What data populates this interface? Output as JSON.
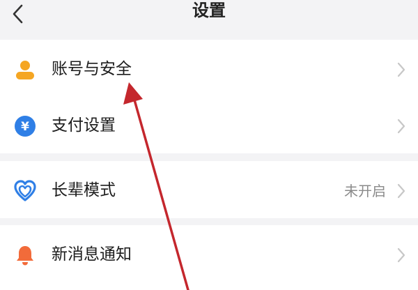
{
  "header": {
    "title": "设置",
    "back_icon": "chevron-left-icon"
  },
  "groups": [
    {
      "items": [
        {
          "label": "账号与安全",
          "icon": "user-icon",
          "icon_color": "#f5a623"
        },
        {
          "label": "支付设置",
          "icon": "yen-coin-icon",
          "icon_color": "#2f7fe6"
        }
      ]
    },
    {
      "items": [
        {
          "label": "长辈模式",
          "value": "未开启",
          "icon": "heart-icon",
          "icon_color": "#2f7fe6"
        }
      ]
    },
    {
      "items": [
        {
          "label": "新消息通知",
          "icon": "bell-icon",
          "icon_color": "#f26b3a"
        }
      ]
    }
  ],
  "annotation": {
    "arrow_color": "#c4272d"
  }
}
